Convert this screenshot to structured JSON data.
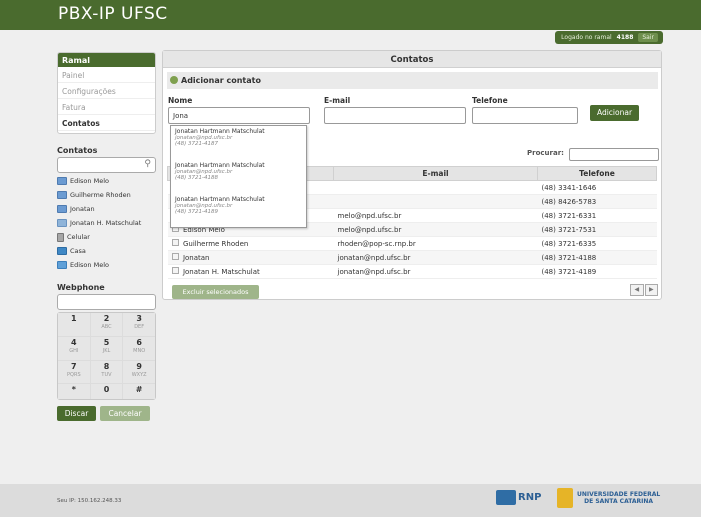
{
  "app": {
    "title": "PBX-IP UFSC"
  },
  "session": {
    "logged_prefix": "Logado no ramal",
    "extension": "4188",
    "logout_label": "Sair"
  },
  "menu": {
    "header": "Ramal",
    "items": [
      {
        "label": "Painel"
      },
      {
        "label": "Configurações"
      },
      {
        "label": "Fatura"
      },
      {
        "label": "Contatos"
      }
    ]
  },
  "contacts_sidebar": {
    "title": "Contatos",
    "items": [
      {
        "label": "Edison Melo",
        "icon": "skype-icon"
      },
      {
        "label": "Guilherme Rhoden",
        "icon": "skype-icon"
      },
      {
        "label": "Jonatan",
        "icon": "skype-icon"
      },
      {
        "label": "Jonatan H. Matschulat",
        "icon": "mobile-icon"
      },
      {
        "label": "Celular",
        "icon": "cellphone-icon"
      },
      {
        "label": "Casa",
        "icon": "home-icon"
      },
      {
        "label": "Edison Melo",
        "icon": "phone-icon"
      }
    ]
  },
  "webphone": {
    "title": "Webphone",
    "keys": [
      {
        "d": "1",
        "l": ""
      },
      {
        "d": "2",
        "l": "ABC"
      },
      {
        "d": "3",
        "l": "DEF"
      },
      {
        "d": "4",
        "l": "GHI"
      },
      {
        "d": "5",
        "l": "JKL"
      },
      {
        "d": "6",
        "l": "MNO"
      },
      {
        "d": "7",
        "l": "PQRS"
      },
      {
        "d": "8",
        "l": "TUV"
      },
      {
        "d": "9",
        "l": "WXYZ"
      },
      {
        "d": "*",
        "l": ""
      },
      {
        "d": "0",
        "l": ""
      },
      {
        "d": "#",
        "l": ""
      }
    ],
    "dial_label": "Discar",
    "cancel_label": "Cancelar"
  },
  "main": {
    "title": "Contatos",
    "add_title": "Adicionar contato",
    "name_label": "Nome",
    "name_value": "Jona",
    "email_label": "E-mail",
    "phone_label": "Telefone",
    "add_button": "Adicionar",
    "search_label": "Procurar:",
    "suggestions": [
      {
        "name": "Jonatan Hartmann Matschulat",
        "email": "jonatan@npd.ufsc.br",
        "phone": "(48) 3721-4187"
      },
      {
        "name": "Jonatan Hartmann Matschulat",
        "email": "jonatan@npd.ufsc.br",
        "phone": "(48) 3721-4188"
      },
      {
        "name": "Jonatan Hartmann Matschulat",
        "email": "jonatan@npd.ufsc.br",
        "phone": "(48) 3721-4189"
      }
    ],
    "table": {
      "headers": [
        "",
        "E-mail",
        "Telefone"
      ],
      "rows": [
        {
          "name": "",
          "email": "",
          "phone": "(48) 3341-1646"
        },
        {
          "name": "",
          "email": "",
          "phone": "(48) 8426-5783"
        },
        {
          "name": "",
          "email": "melo@npd.ufsc.br",
          "phone": "(48) 3721-6331"
        },
        {
          "name": "Edison Melo",
          "email": "melo@npd.ufsc.br",
          "phone": "(48) 3721-7531"
        },
        {
          "name": "Guilherme Rhoden",
          "email": "rhoden@pop-sc.rnp.br",
          "phone": "(48) 3721-6335"
        },
        {
          "name": "Jonatan",
          "email": "jonatan@npd.ufsc.br",
          "phone": "(48) 3721-4188"
        },
        {
          "name": "Jonatan H. Matschulat",
          "email": "jonatan@npd.ufsc.br",
          "phone": "(48) 3721-4189"
        }
      ]
    },
    "delete_button": "Excluir selecionados"
  },
  "footer": {
    "ip_text": "Seu IP: 150.162.248.33",
    "rnp": "RNP",
    "ufsc_line1": "UNIVERSIDADE FEDERAL",
    "ufsc_line2": "DE SANTA CATARINA"
  }
}
